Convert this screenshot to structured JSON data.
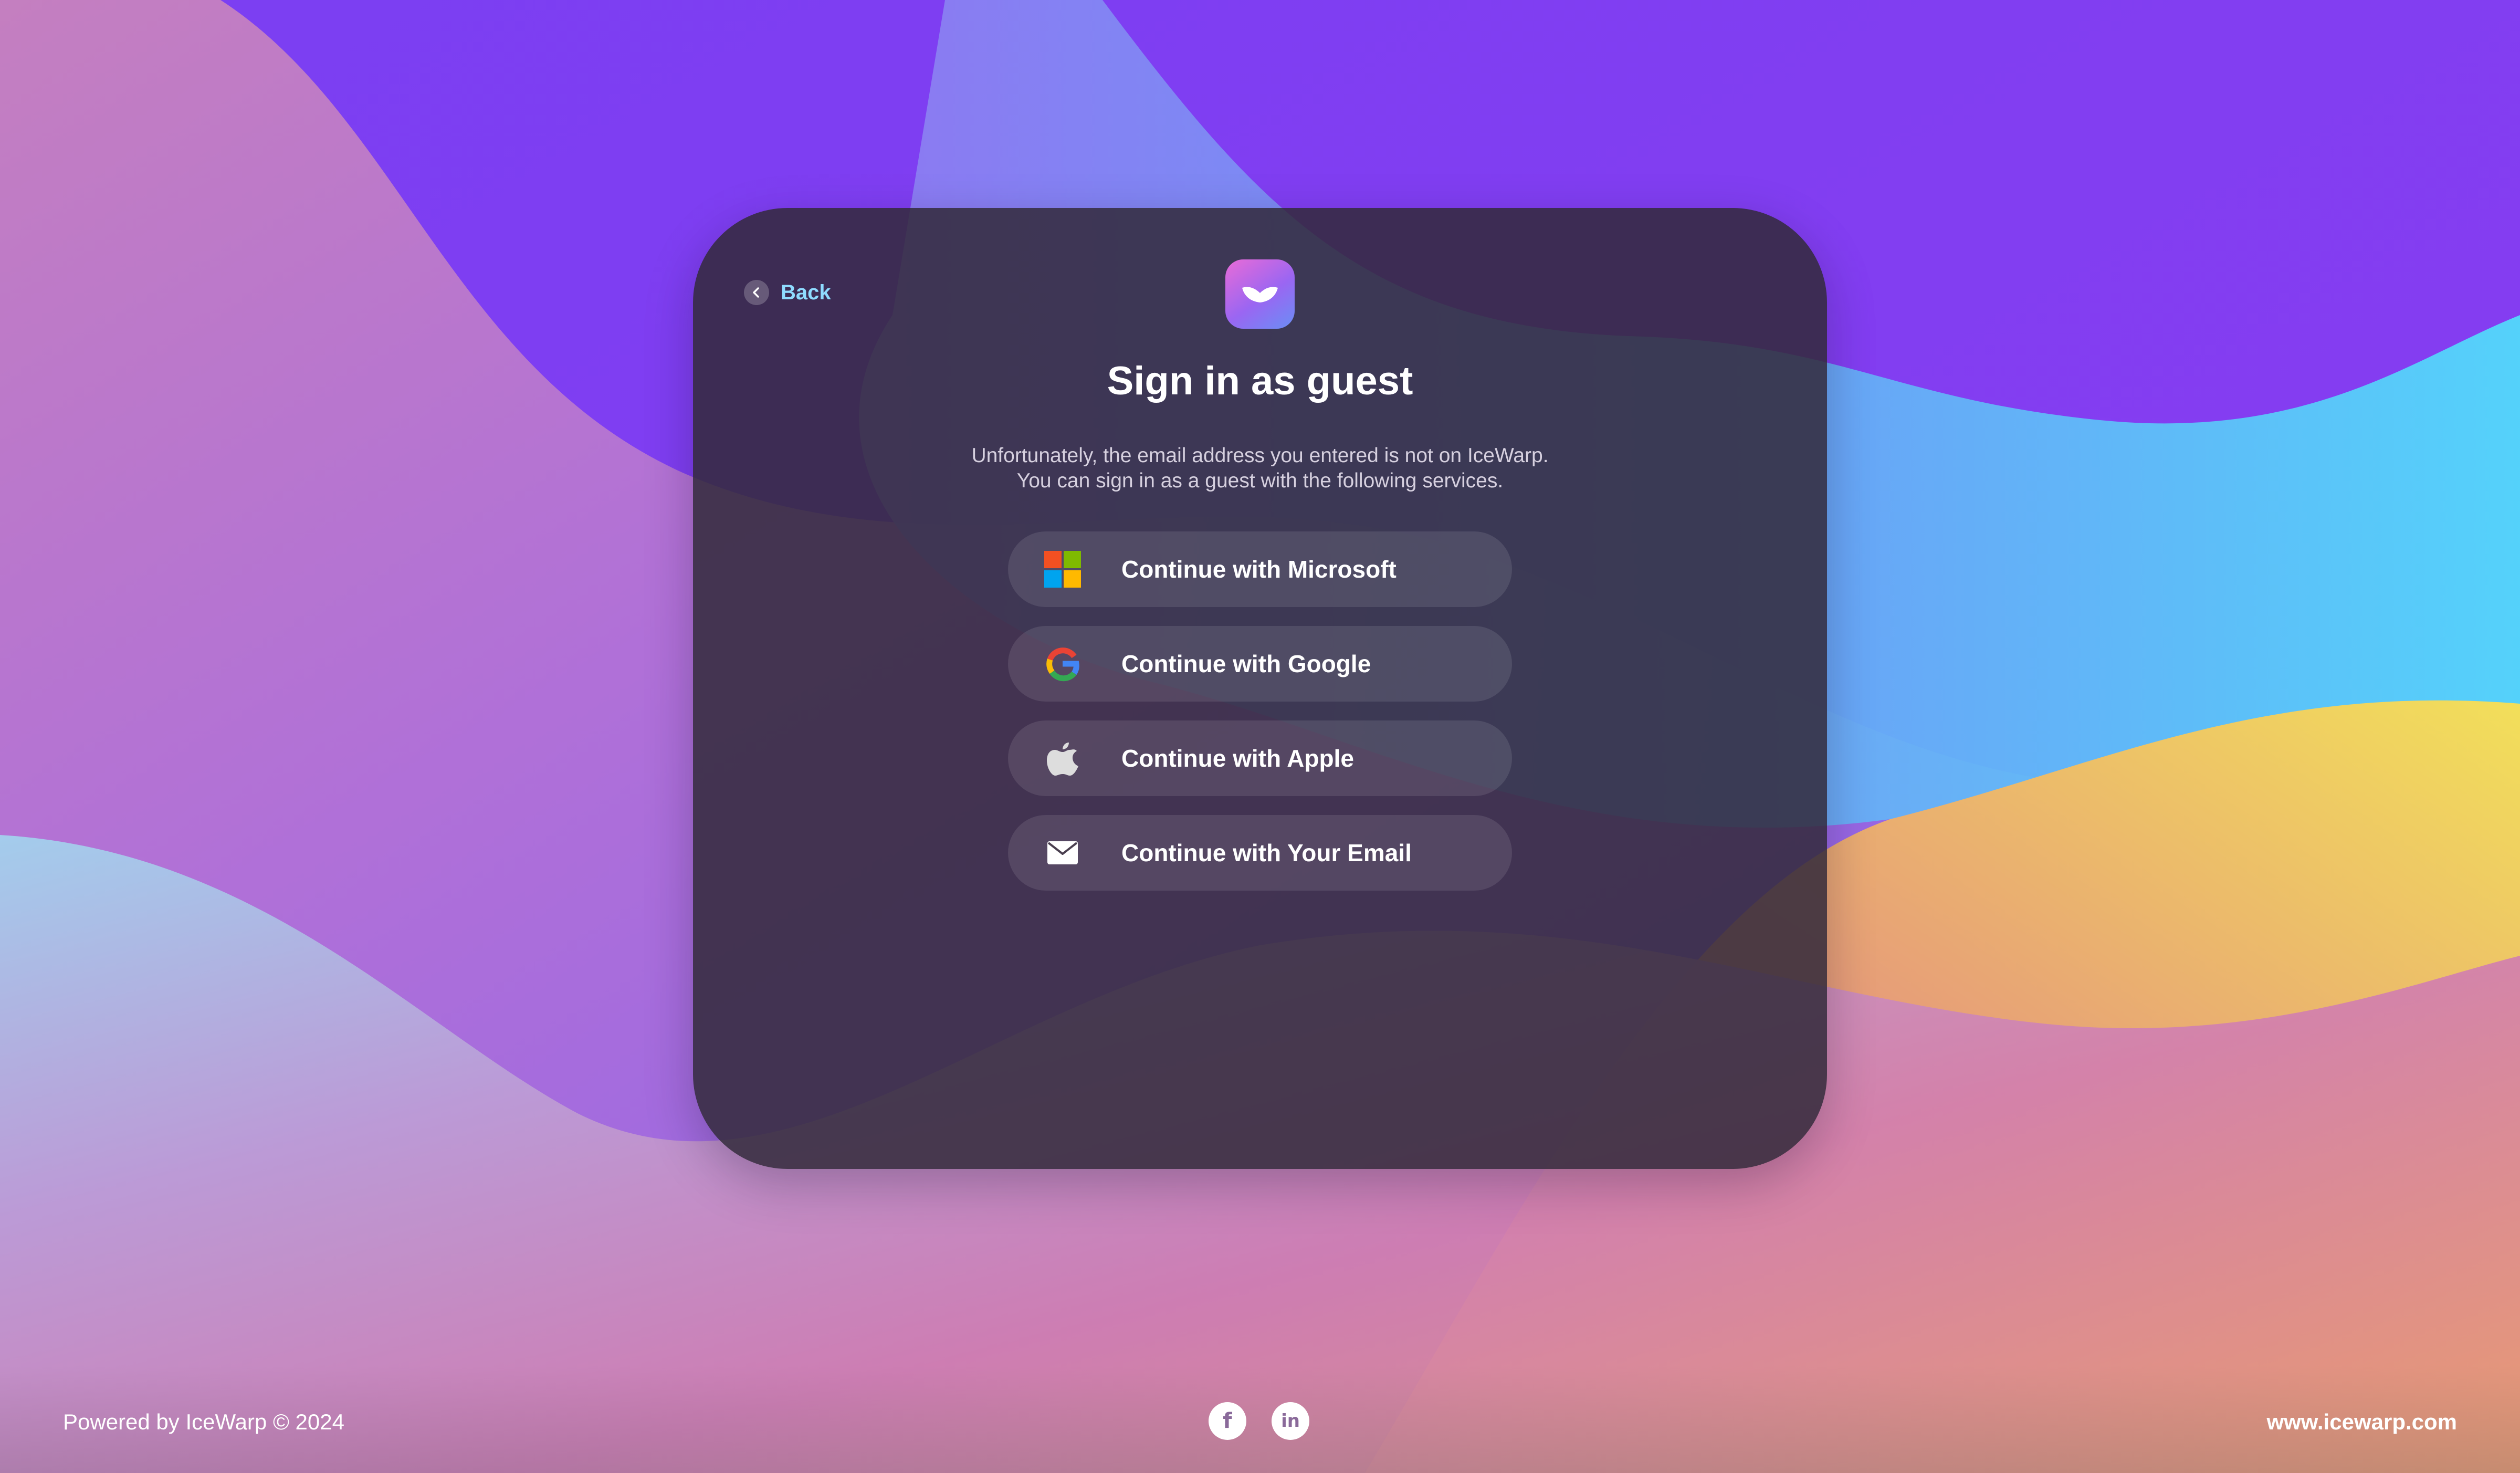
{
  "header": {
    "back_label": "Back",
    "title": "Sign in as guest",
    "message_line1": "Unfortunately, the email address you entered is not on IceWarp.",
    "message_line2": "You can sign in as a guest with the following services."
  },
  "providers": [
    {
      "label": "Continue with Microsoft",
      "icon": "microsoft-icon"
    },
    {
      "label": "Continue with Google",
      "icon": "google-icon"
    },
    {
      "label": "Continue with Apple",
      "icon": "apple-icon"
    },
    {
      "label": "Continue with Your Email",
      "icon": "envelope-icon"
    }
  ],
  "footer": {
    "powered_by": "Powered by IceWarp © 2024",
    "website": "www.icewarp.com",
    "social_icons": [
      "facebook-icon",
      "linkedin-icon"
    ]
  },
  "colors": {
    "back_link": "#8fdcff",
    "card_background": "#322a3a",
    "text": "#ffffff",
    "microsoft_red": "#f25022",
    "microsoft_green": "#7fba00",
    "microsoft_blue": "#00a4ef",
    "microsoft_yellow": "#ffb900"
  }
}
